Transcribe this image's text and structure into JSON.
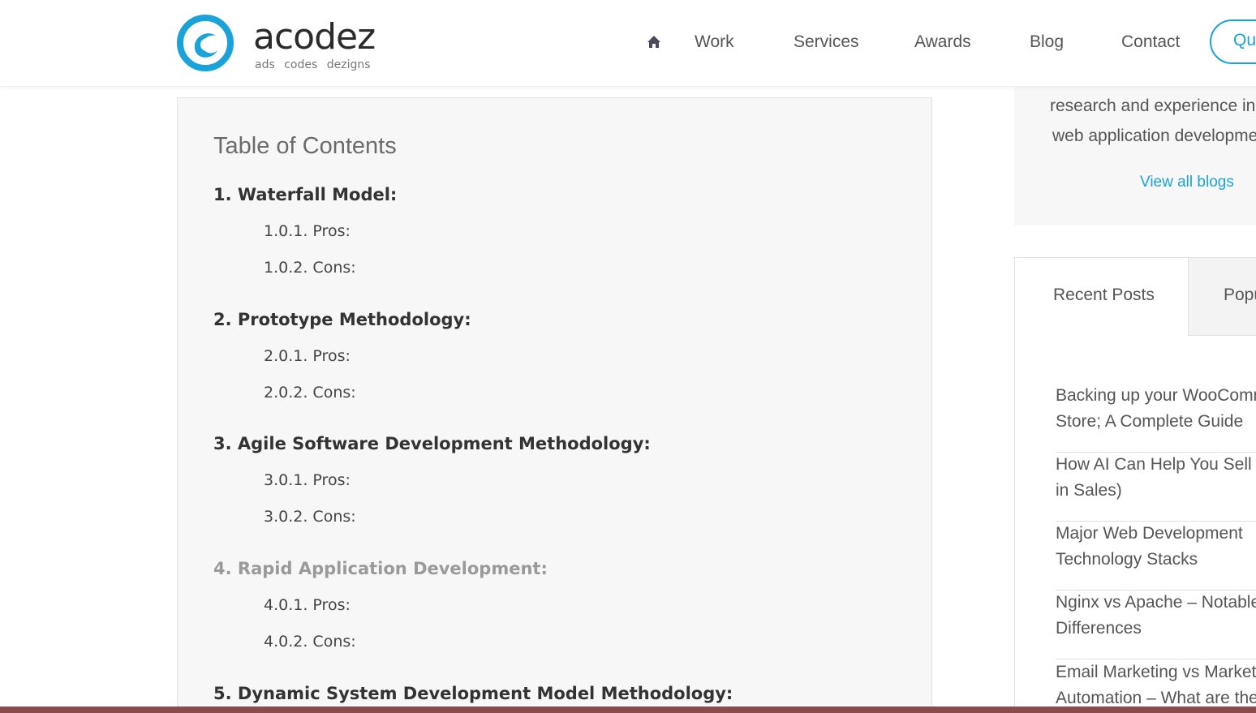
{
  "brand": {
    "name": "acodez",
    "tagline": "ads  codes  dezigns",
    "accent_color": "#1aa3db"
  },
  "nav": {
    "home_icon": "home-icon",
    "items": [
      "Work",
      "Services",
      "Awards",
      "Blog",
      "Contact"
    ],
    "quote_label": "Qu"
  },
  "toc": {
    "title": "Table of Contents",
    "sections": [
      {
        "label": "1. Waterfall Model:",
        "subs": [
          "1.0.1. Pros:",
          "1.0.2. Cons:"
        ]
      },
      {
        "label": "2. Prototype Methodology:",
        "subs": [
          "2.0.1. Pros:",
          "2.0.2. Cons:"
        ]
      },
      {
        "label": "3. Agile Software Development Methodology:",
        "subs": [
          "3.0.1. Pros:",
          "3.0.2. Cons:"
        ]
      },
      {
        "label": "4. Rapid Application Development:",
        "subs": [
          "4.0.1. Pros:",
          "4.0.2. Cons:"
        ]
      },
      {
        "label": "5. Dynamic System Development Model Methodology:",
        "subs": []
      }
    ]
  },
  "sidebar": {
    "about_lines": [
      "research and experience in",
      "web application developme"
    ],
    "view_all": "View all blogs",
    "tabs": [
      "Recent Posts",
      "Popu"
    ],
    "posts": [
      [
        "Backing up your WooComm",
        "Store; A Complete Guide"
      ],
      [
        "How AI Can Help You Sell B",
        "in Sales)"
      ],
      [
        "Major Web Development",
        "Technology Stacks"
      ],
      [
        "Nginx vs Apache – Notable",
        "Differences"
      ],
      [
        "Email Marketing vs Market",
        "Automation – What are the"
      ]
    ]
  }
}
